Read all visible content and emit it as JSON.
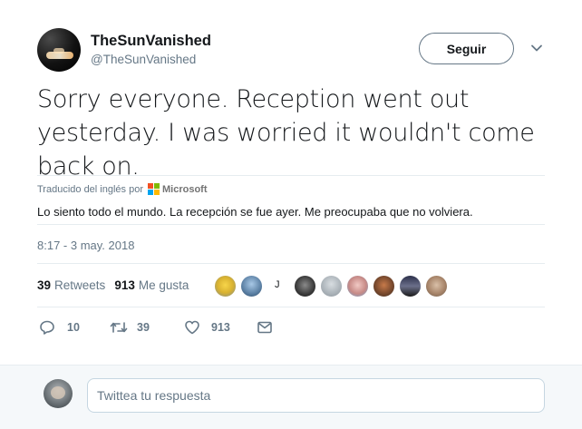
{
  "user": {
    "display_name": "TheSunVanished",
    "screen_name": "@TheSunVanished",
    "avatar_icon": "user-avatar"
  },
  "follow_button": {
    "label": "Seguir"
  },
  "caret_icon": "chevron-down-icon",
  "tweet": {
    "text": "Sorry everyone. Reception went out yesterday. I was worried it wouldn't come back on."
  },
  "translation": {
    "prefix": "Traducido del inglés por",
    "provider": "Microsoft",
    "text": "Lo siento todo el mundo. La recepción se fue ayer. Me preocupaba que no volviera."
  },
  "timestamp": "8:17 - 3 may. 2018",
  "stats": {
    "retweets_count": "39",
    "retweets_label": "Retweets",
    "likes_count": "913",
    "likes_label": "Me gusta"
  },
  "likers": {
    "letter": "J",
    "avatars": [
      "liker-avatar-1",
      "liker-avatar-2",
      "liker-avatar-3",
      "liker-avatar-4",
      "liker-avatar-5",
      "liker-avatar-6",
      "liker-avatar-7",
      "liker-avatar-8"
    ]
  },
  "actions": {
    "reply_count": "10",
    "retweet_count": "39",
    "like_count": "913"
  },
  "reply": {
    "placeholder": "Twittea tu respuesta"
  },
  "colors": {
    "text": "#14171a",
    "secondary": "#657786",
    "divider": "#e6ecf0",
    "ms_red": "#f25022",
    "ms_green": "#7fba00",
    "ms_blue": "#00a4ef",
    "ms_yellow": "#ffb900"
  }
}
